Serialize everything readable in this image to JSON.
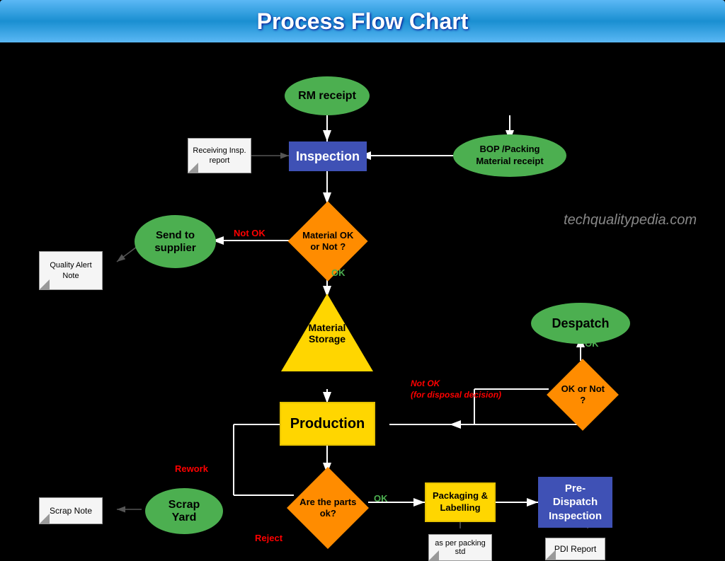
{
  "header": {
    "title": "Process Flow Chart"
  },
  "nodes": {
    "rm_receipt": {
      "label": "RM receipt"
    },
    "inspection": {
      "label": "Inspection"
    },
    "bop_receipt": {
      "label": "BOP /Packing\nMaterial receipt"
    },
    "receiving_report": {
      "label": "Receiving\nInsp. report"
    },
    "material_ok": {
      "label": "Material\nOK or\nNot ?"
    },
    "send_to_supplier": {
      "label": "Send to\nsupplier"
    },
    "quality_alert": {
      "label": "Quality\nAlert Note"
    },
    "material_storage": {
      "label": "Material\nStorage"
    },
    "production": {
      "label": "Production"
    },
    "despatch": {
      "label": "Despatch"
    },
    "ok_or_not": {
      "label": "OK or\nNot ?"
    },
    "are_parts_ok": {
      "label": "Are the\nparts\nok?"
    },
    "packaging": {
      "label": "Packaging &\nLabelling"
    },
    "pdi": {
      "label": "Pre-\nDispatch\nInspection"
    },
    "scrap_yard": {
      "label": "Scrap\nYard"
    },
    "scrap_note": {
      "label": "Scrap Note"
    },
    "pdi_report": {
      "label": "PDI Report"
    },
    "packing_std": {
      "label": "as per\npacking std"
    }
  },
  "labels": {
    "not_ok_1": "Not OK",
    "ok_1": "OK",
    "ok_2": "OK",
    "not_ok_2": "Not OK\n(for disposal decision)",
    "rework": "Rework",
    "reject": "Reject",
    "ok_3": "OK"
  },
  "watermark": "techqualitypedia.com"
}
